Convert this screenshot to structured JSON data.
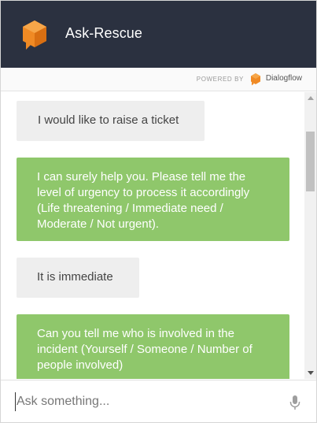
{
  "header": {
    "title": "Ask-Rescue",
    "logo_icon": "cube-logo-icon",
    "background": "#2b3140",
    "logo_color": "#f08a24"
  },
  "powered_by": {
    "label": "POWERED BY",
    "brand": "Dialogflow",
    "brand_icon": "dialogflow-icon"
  },
  "messages": [
    {
      "role": "user",
      "lines": [
        "I would like to raise a ticket"
      ]
    },
    {
      "role": "bot",
      "lines": [
        "I can surely help you. Please tell me the",
        "level of urgency to process it accordingly",
        "(Life threatening / Immediate need /",
        "Moderate / Not urgent)."
      ]
    },
    {
      "role": "user",
      "lines": [
        "It is immediate"
      ]
    },
    {
      "role": "bot",
      "lines": [
        "Can you tell me who is involved in the",
        "incident (Yourself / Someone / Number of",
        "people involved)"
      ]
    }
  ],
  "colors": {
    "user_bubble": "#eeeeee",
    "bot_bubble": "#8fc76b"
  },
  "input": {
    "placeholder": "Ask something...",
    "value": "",
    "mic_icon": "microphone-icon"
  }
}
